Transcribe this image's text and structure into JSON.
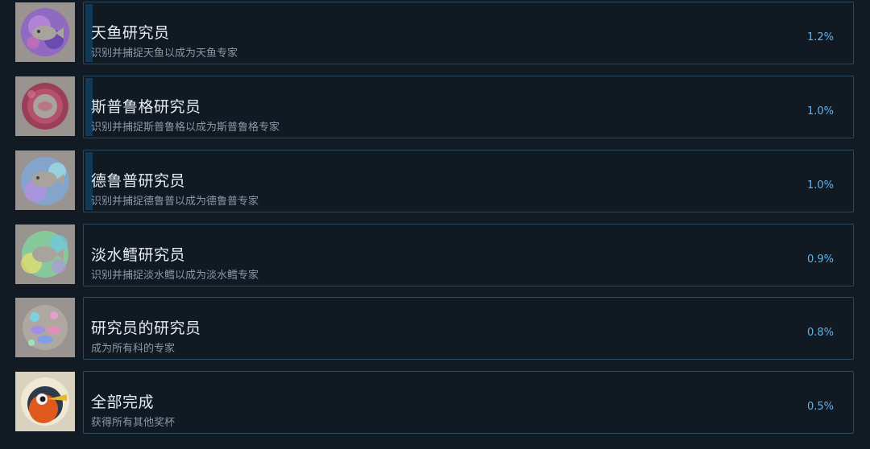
{
  "achievements": [
    {
      "title": "天鱼研究员",
      "description": "识别并捕捉天鱼以成为天鱼专家",
      "percent": "1.2%",
      "icon": "sky-fish-icon",
      "progress_visible": true
    },
    {
      "title": "斯普鲁格研究员",
      "description": "识别并捕捉斯普鲁格以成为斯普鲁格专家",
      "percent": "1.0%",
      "icon": "sprug-icon",
      "progress_visible": true
    },
    {
      "title": "德鲁普研究员",
      "description": "识别并捕捉德鲁普以成为德鲁普专家",
      "percent": "1.0%",
      "icon": "drup-fish-icon",
      "progress_visible": true
    },
    {
      "title": "淡水鳕研究员",
      "description": "识别并捕捉淡水鳕以成为淡水鳕专家",
      "percent": "0.9%",
      "icon": "freshwater-cod-icon",
      "progress_visible": false
    },
    {
      "title": "研究员的研究员",
      "description": "成为所有科的专家",
      "percent": "0.8%",
      "icon": "all-families-icon",
      "progress_visible": false
    },
    {
      "title": "全部完成",
      "description": "获得所有其他奖杯",
      "percent": "0.5%",
      "icon": "bird-trophy-icon",
      "progress_visible": false
    }
  ],
  "colors": {
    "background": "#121a24",
    "card_border": "#2a4a5e",
    "title": "#e6edf3",
    "description": "#8a98a6",
    "percent": "#66b3e6",
    "progress": "#123a58"
  }
}
